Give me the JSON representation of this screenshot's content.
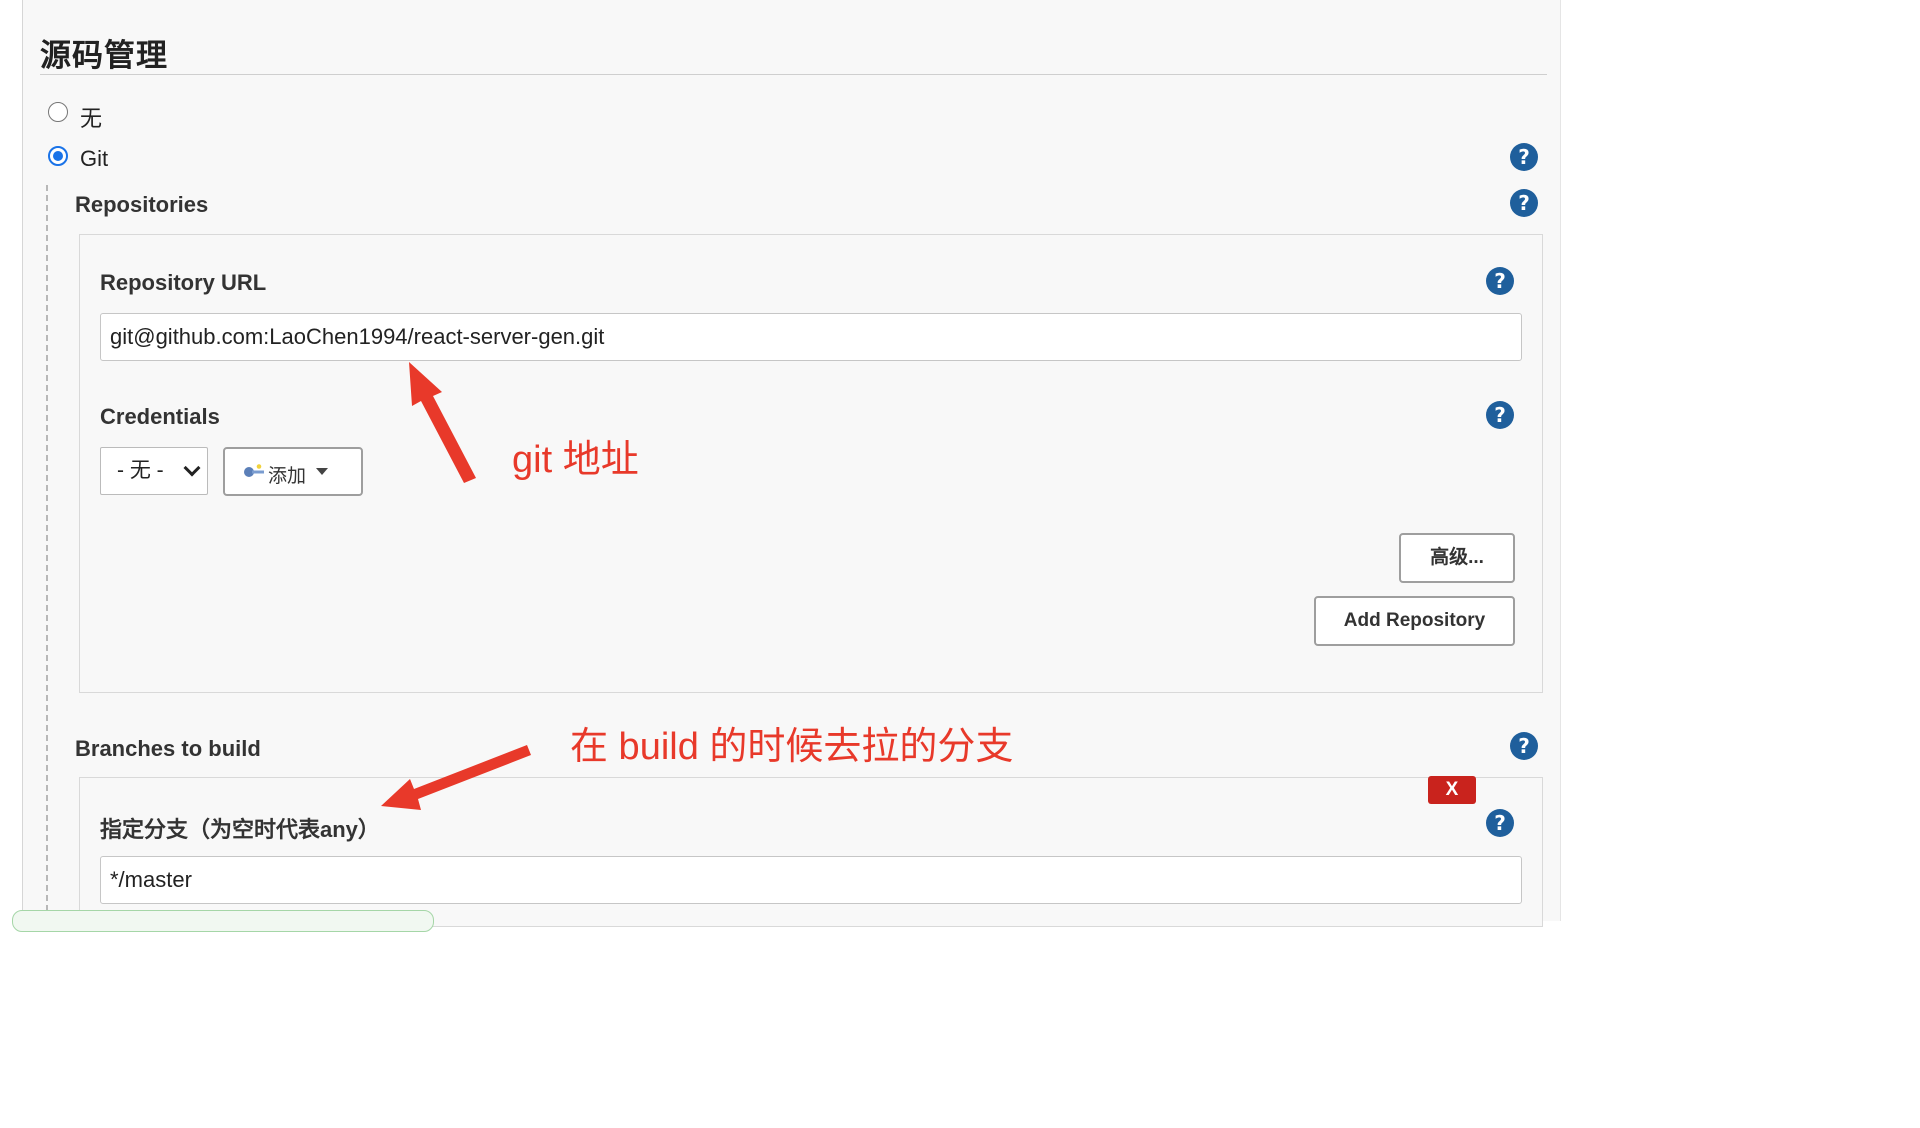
{
  "section": {
    "title": "源码管理"
  },
  "scm": {
    "option_none": "无",
    "option_git": "Git"
  },
  "repositories": {
    "label": "Repositories",
    "url_label": "Repository URL",
    "url_value": "git@github.com:LaoChen1994/react-server-gen.git",
    "credentials_label": "Credentials",
    "credentials_selected": "- 无 -",
    "add_button": "添加",
    "advanced_button": "高级...",
    "add_repository_button": "Add Repository"
  },
  "branches": {
    "label": "Branches to build",
    "spec_label": "指定分支（为空时代表any）",
    "spec_value": "*/master",
    "delete_button": "X"
  },
  "help": {
    "glyph": "?"
  },
  "annotations": {
    "git_address": "git 地址",
    "branch_note": "在 build 的时候去拉的分支"
  },
  "colors": {
    "annotation": "#e8392a",
    "help_icon": "#1f5f9c",
    "radio_checked": "#1a73e8",
    "delete_button": "#c9231d"
  }
}
